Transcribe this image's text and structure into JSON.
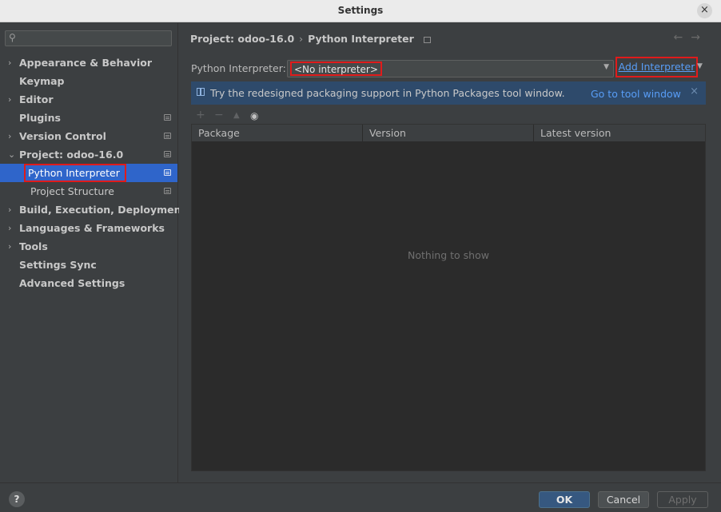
{
  "window": {
    "title": "Settings",
    "close_glyph": "×"
  },
  "sidebar": {
    "search": {
      "value": "",
      "placeholder": ""
    },
    "items": [
      {
        "label": "Appearance & Behavior",
        "expandable": true,
        "expanded": false,
        "child": false
      },
      {
        "label": "Keymap",
        "expandable": false,
        "child": false
      },
      {
        "label": "Editor",
        "expandable": true,
        "expanded": false,
        "child": false
      },
      {
        "label": "Plugins",
        "expandable": false,
        "child": false,
        "has_icon": true
      },
      {
        "label": "Version Control",
        "expandable": true,
        "expanded": false,
        "child": false,
        "has_icon": true
      },
      {
        "label": "Project: odoo-16.0",
        "expandable": true,
        "expanded": true,
        "child": false,
        "has_icon": true
      },
      {
        "label": "Python Interpreter",
        "expandable": false,
        "child": true,
        "selected": true,
        "has_icon": true
      },
      {
        "label": "Project Structure",
        "expandable": false,
        "child": true,
        "has_icon": true
      },
      {
        "label": "Build, Execution, Deployment",
        "expandable": true,
        "expanded": false,
        "child": false
      },
      {
        "label": "Languages & Frameworks",
        "expandable": true,
        "expanded": false,
        "child": false
      },
      {
        "label": "Tools",
        "expandable": true,
        "expanded": false,
        "child": false
      },
      {
        "label": "Settings Sync",
        "expandable": false,
        "child": false
      },
      {
        "label": "Advanced Settings",
        "expandable": false,
        "child": false
      }
    ]
  },
  "content": {
    "breadcrumb": {
      "project": "Project: odoo-16.0",
      "separator": "›",
      "page": "Python Interpreter"
    },
    "nav": {
      "back": "←",
      "forward": "→"
    },
    "interpreter": {
      "label": "Python Interpreter:",
      "value": "<No interpreter>",
      "add_label": "Add Interpreter"
    },
    "banner": {
      "text": "Try the redesigned packaging support in Python Packages tool window.",
      "link": "Go to tool window",
      "close_glyph": "×",
      "color": "#2e4a6b"
    },
    "toolbar": {
      "add": "+",
      "remove": "−",
      "upgrade": "▲",
      "show": "👁"
    },
    "table": {
      "columns": [
        "Package",
        "Version",
        "Latest version"
      ],
      "rows": [],
      "empty_text": "Nothing to show"
    }
  },
  "footer": {
    "help": "?",
    "ok": "OK",
    "cancel": "Cancel",
    "apply": "Apply"
  },
  "colors": {
    "accent": "#2f65ca",
    "link": "#589df6",
    "highlight_box": "#e01b1b"
  }
}
